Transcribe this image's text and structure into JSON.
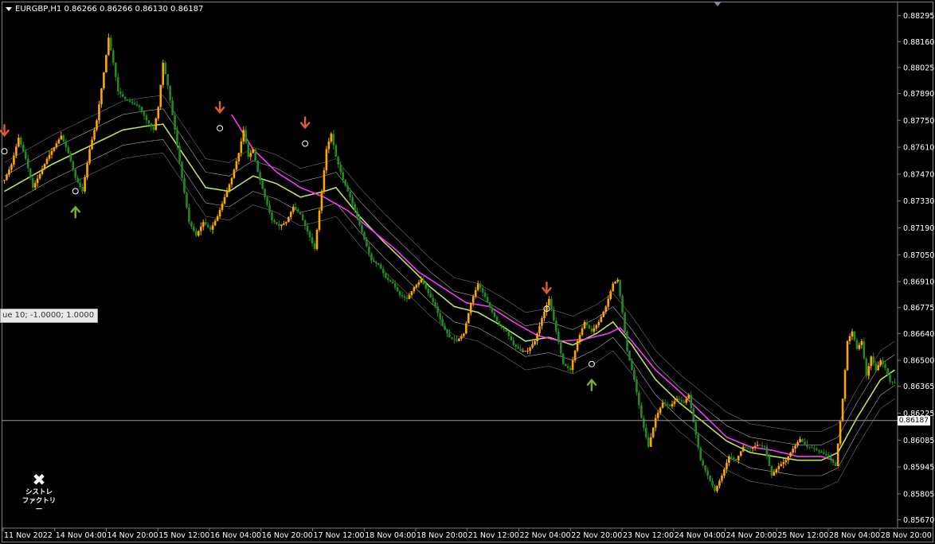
{
  "header": {
    "symbol_line": "EURGBP,H1  0.86266 0.86266 0.86130 0.86187"
  },
  "tooltip_text": "ue 10; -1.0000; 1.0000",
  "logo": {
    "icon": "tools-icon",
    "line1": "シストレ",
    "line2": "ファクトリー"
  },
  "current_price_label": "0.86187",
  "colors": {
    "background": "#000000",
    "bull_candle": "#ffa500",
    "bear_candle": "#1f8a1f",
    "ma_magenta": "#ff33ff",
    "ma_green": "#b8e35a",
    "band_lines": "#c8c8c8",
    "sell_arrow": "#e05a3a",
    "buy_arrow": "#7ab030"
  },
  "chart_data": {
    "type": "candlestick",
    "symbol": "EURGBP",
    "timeframe": "H1",
    "ylim": [
      0.85635,
      0.8836
    ],
    "y_ticks": [
      "0.88295",
      "0.88160",
      "0.88025",
      "0.87890",
      "0.87750",
      "0.87610",
      "0.87470",
      "0.87330",
      "0.87190",
      "0.87050",
      "0.86910",
      "0.86775",
      "0.86640",
      "0.86500",
      "0.86365",
      "0.86225",
      "0.86085",
      "0.85945",
      "0.85805",
      "0.85670"
    ],
    "x_ticks": [
      "11 Nov 2022",
      "14 Nov 04:00",
      "14 Nov 20:00",
      "15 Nov 12:00",
      "16 Nov 04:00",
      "16 Nov 20:00",
      "17 Nov 12:00",
      "18 Nov 04:00",
      "18 Nov 20:00",
      "21 Nov 12:00",
      "22 Nov 04:00",
      "22 Nov 20:00",
      "23 Nov 12:00",
      "24 Nov 04:00",
      "24 Nov 20:00",
      "25 Nov 12:00",
      "28 Nov 04:00",
      "28 Nov 20:00"
    ],
    "current_price": 0.86187,
    "price_path": [
      [
        0,
        0.8744
      ],
      [
        3,
        0.8752
      ],
      [
        6,
        0.8766
      ],
      [
        9,
        0.8755
      ],
      [
        12,
        0.874
      ],
      [
        15,
        0.8747
      ],
      [
        18,
        0.8755
      ],
      [
        21,
        0.8761
      ],
      [
        24,
        0.8767
      ],
      [
        27,
        0.8758
      ],
      [
        30,
        0.8745
      ],
      [
        33,
        0.8738
      ],
      [
        36,
        0.876
      ],
      [
        39,
        0.8775
      ],
      [
        42,
        0.88
      ],
      [
        44,
        0.8818
      ],
      [
        46,
        0.8805
      ],
      [
        48,
        0.879
      ],
      [
        51,
        0.8786
      ],
      [
        54,
        0.8784
      ],
      [
        57,
        0.8782
      ],
      [
        60,
        0.8775
      ],
      [
        63,
        0.877
      ],
      [
        65,
        0.8782
      ],
      [
        67,
        0.8805
      ],
      [
        69,
        0.8793
      ],
      [
        72,
        0.877
      ],
      [
        75,
        0.8745
      ],
      [
        78,
        0.8722
      ],
      [
        81,
        0.8715
      ],
      [
        84,
        0.8722
      ],
      [
        87,
        0.8718
      ],
      [
        90,
        0.8725
      ],
      [
        93,
        0.8735
      ],
      [
        96,
        0.8745
      ],
      [
        99,
        0.8758
      ],
      [
        101,
        0.877
      ],
      [
        103,
        0.8756
      ],
      [
        105,
        0.876
      ],
      [
        107,
        0.8748
      ],
      [
        110,
        0.8735
      ],
      [
        113,
        0.8723
      ],
      [
        116,
        0.872
      ],
      [
        119,
        0.8722
      ],
      [
        122,
        0.873
      ],
      [
        125,
        0.8726
      ],
      [
        128,
        0.8717
      ],
      [
        131,
        0.8708
      ],
      [
        134,
        0.8738
      ],
      [
        136,
        0.876
      ],
      [
        138,
        0.8768
      ],
      [
        140,
        0.8756
      ],
      [
        143,
        0.8744
      ],
      [
        146,
        0.8735
      ],
      [
        149,
        0.8724
      ],
      [
        152,
        0.8713
      ],
      [
        155,
        0.8702
      ],
      [
        158,
        0.87
      ],
      [
        161,
        0.8693
      ],
      [
        164,
        0.869
      ],
      [
        167,
        0.8684
      ],
      [
        170,
        0.8682
      ],
      [
        173,
        0.8688
      ],
      [
        176,
        0.8692
      ],
      [
        179,
        0.8685
      ],
      [
        182,
        0.8678
      ],
      [
        185,
        0.8668
      ],
      [
        188,
        0.8662
      ],
      [
        191,
        0.866
      ],
      [
        194,
        0.8664
      ],
      [
        197,
        0.868
      ],
      [
        200,
        0.869
      ],
      [
        203,
        0.8683
      ],
      [
        206,
        0.8675
      ],
      [
        209,
        0.8668
      ],
      [
        212,
        0.8665
      ],
      [
        215,
        0.8658
      ],
      [
        218,
        0.8655
      ],
      [
        221,
        0.8655
      ],
      [
        224,
        0.866
      ],
      [
        227,
        0.8672
      ],
      [
        230,
        0.8682
      ],
      [
        233,
        0.8665
      ],
      [
        236,
        0.8648
      ],
      [
        239,
        0.8645
      ],
      [
        242,
        0.866
      ],
      [
        245,
        0.867
      ],
      [
        248,
        0.8665
      ],
      [
        251,
        0.867
      ],
      [
        254,
        0.8678
      ],
      [
        257,
        0.869
      ],
      [
        259,
        0.8692
      ],
      [
        261,
        0.8675
      ],
      [
        263,
        0.8655
      ],
      [
        266,
        0.864
      ],
      [
        269,
        0.862
      ],
      [
        272,
        0.8605
      ],
      [
        275,
        0.862
      ],
      [
        278,
        0.8628
      ],
      [
        281,
        0.8626
      ],
      [
        284,
        0.863
      ],
      [
        287,
        0.8628
      ],
      [
        289,
        0.8632
      ],
      [
        291,
        0.8618
      ],
      [
        294,
        0.8598
      ],
      [
        297,
        0.859
      ],
      [
        300,
        0.8582
      ],
      [
        303,
        0.859
      ],
      [
        306,
        0.86
      ],
      [
        309,
        0.8598
      ],
      [
        312,
        0.8605
      ],
      [
        315,
        0.8604
      ],
      [
        318,
        0.8606
      ],
      [
        321,
        0.8605
      ],
      [
        324,
        0.859
      ],
      [
        327,
        0.8595
      ],
      [
        330,
        0.8598
      ],
      [
        333,
        0.8604
      ],
      [
        336,
        0.8609
      ],
      [
        339,
        0.8605
      ],
      [
        342,
        0.8604
      ],
      [
        345,
        0.8602
      ],
      [
        348,
        0.86
      ],
      [
        351,
        0.8595
      ],
      [
        354,
        0.863
      ],
      [
        356,
        0.866
      ],
      [
        358,
        0.8665
      ],
      [
        360,
        0.8656
      ],
      [
        362,
        0.866
      ],
      [
        364,
        0.8642
      ],
      [
        366,
        0.8652
      ],
      [
        368,
        0.8645
      ],
      [
        370,
        0.865
      ],
      [
        372,
        0.8646
      ],
      [
        374,
        0.8639
      ],
      [
        376,
        0.8638
      ]
    ],
    "ma_magenta_path": [
      [
        96,
        0.8778
      ],
      [
        105,
        0.876
      ],
      [
        115,
        0.8748
      ],
      [
        125,
        0.874
      ],
      [
        135,
        0.8735
      ],
      [
        145,
        0.8728
      ],
      [
        155,
        0.8718
      ],
      [
        165,
        0.8708
      ],
      [
        175,
        0.8696
      ],
      [
        185,
        0.8688
      ],
      [
        195,
        0.868
      ],
      [
        205,
        0.8678
      ],
      [
        215,
        0.867
      ],
      [
        225,
        0.8663
      ],
      [
        235,
        0.866
      ],
      [
        245,
        0.8661
      ],
      [
        255,
        0.8664
      ],
      [
        260,
        0.8667
      ],
      [
        265,
        0.866
      ],
      [
        275,
        0.8645
      ],
      [
        285,
        0.8634
      ],
      [
        295,
        0.8622
      ],
      [
        305,
        0.861
      ],
      [
        315,
        0.8605
      ],
      [
        325,
        0.8603
      ],
      [
        335,
        0.86
      ],
      [
        345,
        0.86
      ],
      [
        350,
        0.8598
      ]
    ],
    "ma_green_path": [
      [
        0,
        0.8738
      ],
      [
        10,
        0.8745
      ],
      [
        20,
        0.8752
      ],
      [
        30,
        0.8758
      ],
      [
        40,
        0.8764
      ],
      [
        50,
        0.877
      ],
      [
        60,
        0.8772
      ],
      [
        67,
        0.8773
      ],
      [
        85,
        0.874
      ],
      [
        95,
        0.8738
      ],
      [
        105,
        0.8746
      ],
      [
        115,
        0.8742
      ],
      [
        125,
        0.8735
      ],
      [
        135,
        0.8738
      ],
      [
        140,
        0.874
      ],
      [
        150,
        0.8725
      ],
      [
        160,
        0.8712
      ],
      [
        170,
        0.87
      ],
      [
        180,
        0.8688
      ],
      [
        190,
        0.8678
      ],
      [
        200,
        0.8675
      ],
      [
        210,
        0.8668
      ],
      [
        220,
        0.866
      ],
      [
        230,
        0.8662
      ],
      [
        240,
        0.8658
      ],
      [
        250,
        0.8664
      ],
      [
        257,
        0.867
      ],
      [
        265,
        0.8658
      ],
      [
        275,
        0.864
      ],
      [
        285,
        0.8628
      ],
      [
        295,
        0.8618
      ],
      [
        305,
        0.8608
      ],
      [
        315,
        0.8602
      ],
      [
        325,
        0.86
      ],
      [
        335,
        0.8598
      ],
      [
        345,
        0.8598
      ],
      [
        352,
        0.8602
      ],
      [
        360,
        0.862
      ],
      [
        370,
        0.864
      ],
      [
        376,
        0.8645
      ]
    ],
    "sell_arrows": [
      [
        0,
        0.8768
      ],
      [
        91,
        0.878
      ],
      [
        127,
        0.8772
      ],
      [
        229,
        0.8686
      ]
    ],
    "buy_arrows": [
      [
        30,
        0.8729
      ],
      [
        248,
        0.8639
      ]
    ],
    "legend": "none",
    "grid": false
  }
}
